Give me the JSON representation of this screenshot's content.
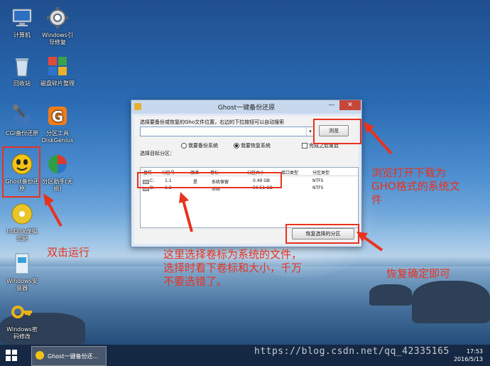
{
  "desktop": {
    "icons": [
      {
        "label": "计算机"
      },
      {
        "label": "Windows引\n导修复"
      },
      {
        "label": "回收站"
      },
      {
        "label": "磁盘碎片整理"
      },
      {
        "label": "CGI备份还原"
      },
      {
        "label": "分区工具\nDiskGenius"
      },
      {
        "label": "Ghost备份还\n原"
      },
      {
        "label": "分区助手(无\n损)"
      },
      {
        "label": "ImDisk虚拟\n光驱"
      },
      {
        "label": "Windows安\n装器"
      },
      {
        "label": "Windows密\n码修改"
      }
    ]
  },
  "window": {
    "title": "Ghost一键备份还原",
    "minimize": "—",
    "close": "✕",
    "prompt": "选择要备份或恢复的Gho文件位置，右边的下拉按钮可以自动搜索",
    "path_value": "",
    "browse_button": "浏览",
    "target_label": "选择目标分区：",
    "radio_backup": "我要备份系统",
    "radio_restore": "我要恢复系统",
    "check_restart": "完成之后重启",
    "columns": [
      "盘符",
      "分区号",
      "激活",
      "卷标",
      "分区大小",
      "接口类型",
      "分区类型"
    ],
    "rows": [
      {
        "drive": "C:",
        "partition": "1:1",
        "active": "是",
        "label": "系统保留",
        "size": "0.49 GB",
        "interface": "",
        "type": "NTFS"
      },
      {
        "drive": "D:",
        "partition": "1:2",
        "active": "",
        "label": "系统",
        "size": "59.51 GB",
        "interface": "",
        "type": "NTFS"
      }
    ],
    "restore_button": "恢复选择的分区"
  },
  "annotations": {
    "browse_note": "浏览打开下载为\nGHO格式的系统文\n件",
    "double_click_note": "双击运行",
    "select_note": "这里选择卷标为系统的文件，\n选择时看下卷标和大小，千万\n不要选错了。",
    "restore_note": "恢复确定即可"
  },
  "taskbar": {
    "task_label": "Ghost一键备份还...",
    "time": "17:53",
    "date": "2016/5/13"
  },
  "watermark": "https://blog.csdn.net/qq_42335165",
  "colors": {
    "annotation": "#e8321f",
    "window_title_bar": "#c8d9ee",
    "close_button": "#c7463a"
  }
}
